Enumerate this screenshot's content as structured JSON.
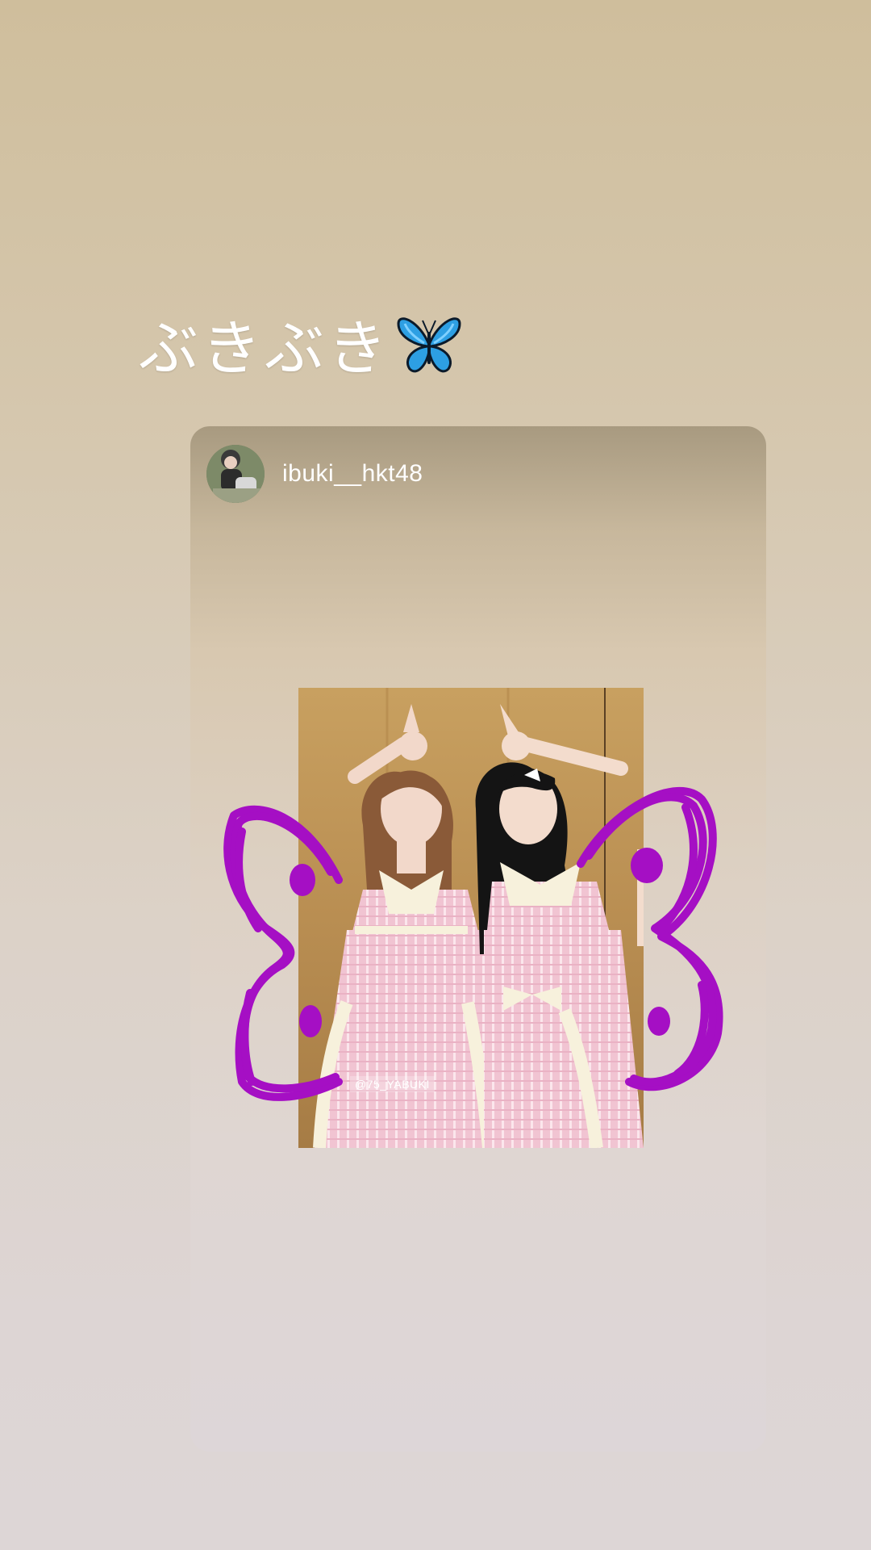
{
  "story": {
    "caption": "ぶきぶき",
    "caption_emoji": "butterfly-emoji"
  },
  "post": {
    "username": "ibuki__hkt48",
    "avatar_icon": "avatar",
    "photo_watermark": "@75_YABUKI"
  },
  "colors": {
    "doodle": "#a50fc4",
    "background_top": "#cfbe9c",
    "background_bottom": "#ddd6d6"
  }
}
